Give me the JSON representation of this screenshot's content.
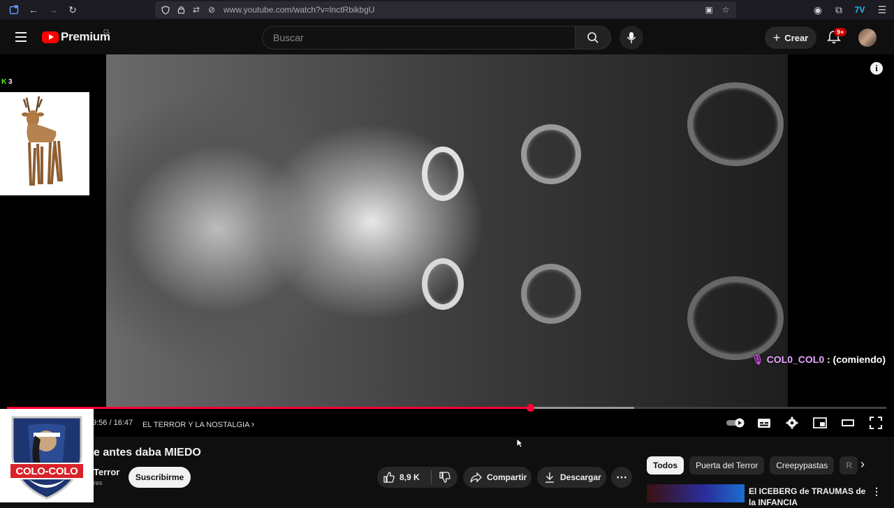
{
  "browser": {
    "url": "www.youtube.com/watch?v=lnctRbikbgU"
  },
  "header": {
    "logo_text": "Premium",
    "country_code": "CL",
    "search_placeholder": "Buscar",
    "create_label": "Crear",
    "notification_count": "9+"
  },
  "player": {
    "kick_viewers": "3",
    "chat_user": "COL0_COL0",
    "chat_message": ": (comiendo)",
    "current_time": "9:56 / 16:47",
    "chapter": "EL TERROR Y LA NOSTALGIA",
    "progress_fraction": 0.595,
    "buffered_fraction": 0.713
  },
  "video": {
    "title": "e antes daba MIEDO",
    "channel": "Terror",
    "subscribers": "res",
    "subscribe_label": "Suscribirme",
    "likes": "8,9 K",
    "share_label": "Compartir",
    "download_label": "Descargar"
  },
  "sidebar": {
    "chips": [
      "Todos",
      "Puerta del Terror",
      "Creepypastas",
      "R"
    ],
    "rec_title": "El ICEBERG de TRAUMAS de la INFANCIA"
  },
  "overlay": {
    "team_name": "COLO-COLO"
  },
  "colors": {
    "accent": "#ff0033",
    "kick_green": "#53fc18",
    "chat_name": "#e9a7ff"
  }
}
